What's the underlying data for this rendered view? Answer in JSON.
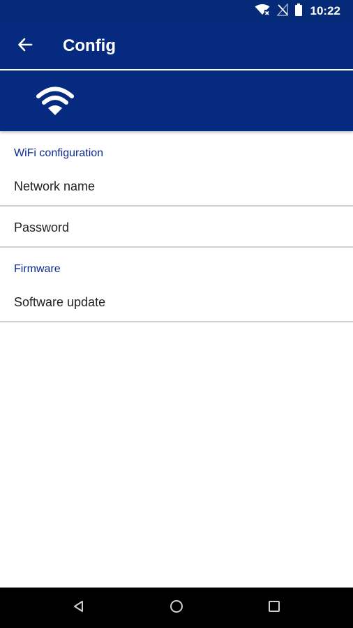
{
  "status_bar": {
    "time": "10:22",
    "icons": [
      "wifi-no-internet-icon",
      "no-signal-icon",
      "battery-icon"
    ]
  },
  "app_bar": {
    "title": "Config",
    "back_icon": "back-arrow-icon"
  },
  "header": {
    "icon": "wifi-icon"
  },
  "sections": [
    {
      "title": "WiFi configuration",
      "items": [
        "Network name",
        "Password"
      ]
    },
    {
      "title": "Firmware",
      "items": [
        "Software update"
      ]
    }
  ],
  "nav_bar": {
    "icons": [
      "back-triangle-icon",
      "home-circle-icon",
      "recents-square-icon"
    ]
  },
  "colors": {
    "primary": "#052a80",
    "section_header": "#0a2a8a",
    "divider": "#cfcfcf"
  }
}
